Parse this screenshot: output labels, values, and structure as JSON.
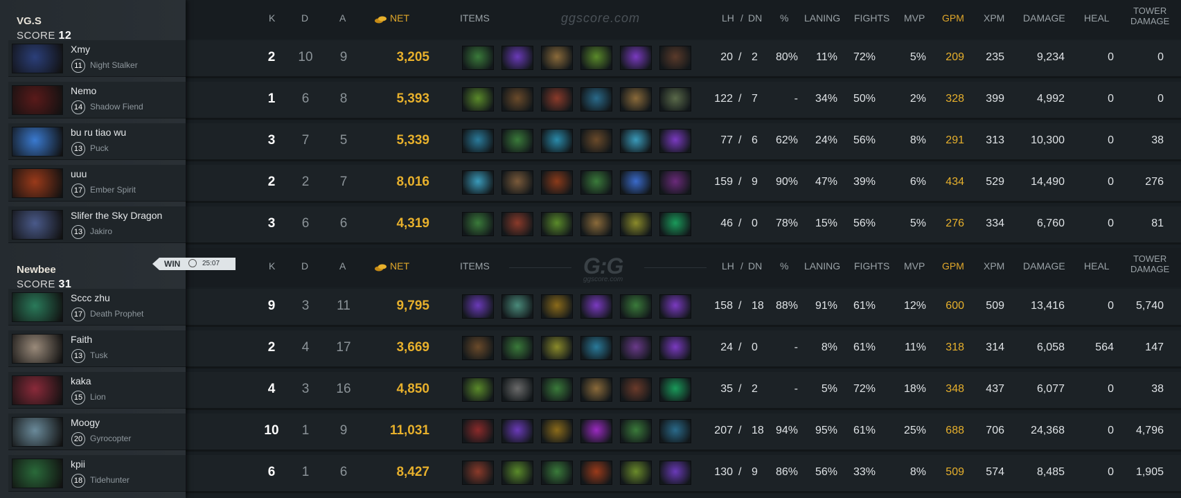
{
  "teams": [
    {
      "name": "VG.S",
      "score_label": "SCORE",
      "score": "12",
      "players": [
        {
          "name": "Xmy",
          "level": "11",
          "hero": "Night Stalker",
          "k": "2",
          "d": "10",
          "a": "9",
          "net": "3,205",
          "lh": "20",
          "dn": "2",
          "pct": "80%",
          "laning": "11%",
          "fights": "72%",
          "mvp": "5%",
          "gpm": "209",
          "xpm": "235",
          "damage": "9,234",
          "heal": "0",
          "tower": "0",
          "items": [
            "#3a7a3a",
            "#6a3ab8",
            "#8a6a3a",
            "#5a8a2a",
            "#7a3ac0",
            "#5a3a2a"
          ],
          "portrait": "#2b3f7a"
        },
        {
          "name": "Nemo",
          "level": "14",
          "hero": "Shadow Fiend",
          "k": "1",
          "d": "6",
          "a": "8",
          "net": "5,393",
          "lh": "122",
          "dn": "7",
          "pct": "-",
          "laning": "34%",
          "fights": "50%",
          "mvp": "2%",
          "gpm": "328",
          "xpm": "399",
          "damage": "4,992",
          "heal": "0",
          "tower": "0",
          "items": [
            "#5a8a2a",
            "#6a4a2a",
            "#8a3a2a",
            "#2a6a8a",
            "#8a6a3a",
            "#5a6a4a"
          ],
          "portrait": "#5a1a1a"
        },
        {
          "name": "bu ru tiao wu",
          "level": "13",
          "hero": "Puck",
          "k": "3",
          "d": "7",
          "a": "5",
          "net": "5,339",
          "lh": "77",
          "dn": "6",
          "pct": "62%",
          "laning": "24%",
          "fights": "56%",
          "mvp": "8%",
          "gpm": "291",
          "xpm": "313",
          "damage": "10,300",
          "heal": "0",
          "tower": "38",
          "items": [
            "#2a7a9a",
            "#3a7a3a",
            "#2a8aaa",
            "#6a4a2a",
            "#3a9aba",
            "#7a3ac0"
          ],
          "portrait": "#3a7ad0"
        },
        {
          "name": "uuu",
          "level": "17",
          "hero": "Ember Spirit",
          "k": "2",
          "d": "2",
          "a": "7",
          "net": "8,016",
          "lh": "159",
          "dn": "9",
          "pct": "90%",
          "laning": "47%",
          "fights": "39%",
          "mvp": "6%",
          "gpm": "434",
          "xpm": "529",
          "damage": "14,490",
          "heal": "0",
          "tower": "276",
          "items": [
            "#3a9aba",
            "#7a5a3a",
            "#8a3a1a",
            "#3a7a3a",
            "#3a6aca",
            "#6a2a7a"
          ],
          "portrait": "#9a3a1a"
        },
        {
          "name": "Slifer the Sky Dragon",
          "level": "13",
          "hero": "Jakiro",
          "k": "3",
          "d": "6",
          "a": "6",
          "net": "4,319",
          "lh": "46",
          "dn": "0",
          "pct": "78%",
          "laning": "15%",
          "fights": "56%",
          "mvp": "5%",
          "gpm": "276",
          "xpm": "334",
          "damage": "6,760",
          "heal": "0",
          "tower": "81",
          "items": [
            "#3a7a3a",
            "#8a3a2a",
            "#5a8a2a",
            "#8a6a3a",
            "#8a8a2a",
            "#1a9a5a"
          ],
          "portrait": "#4a5a8a"
        }
      ]
    },
    {
      "name": "Newbee",
      "score_label": "SCORE",
      "score": "31",
      "players": [
        {
          "name": "Sccc zhu",
          "level": "17",
          "hero": "Death Prophet",
          "k": "9",
          "d": "3",
          "a": "11",
          "net": "9,795",
          "lh": "158",
          "dn": "18",
          "pct": "88%",
          "laning": "91%",
          "fights": "61%",
          "mvp": "12%",
          "gpm": "600",
          "xpm": "509",
          "damage": "13,416",
          "heal": "0",
          "tower": "5,740",
          "items": [
            "#6a3ab8",
            "#4a8a7a",
            "#8a6a1a",
            "#7a3ac0",
            "#3a7a3a",
            "#7a3ac0"
          ],
          "portrait": "#2a7a5a"
        },
        {
          "name": "Faith",
          "level": "13",
          "hero": "Tusk",
          "k": "2",
          "d": "4",
          "a": "17",
          "net": "3,669",
          "lh": "24",
          "dn": "0",
          "pct": "-",
          "laning": "8%",
          "fights": "61%",
          "mvp": "11%",
          "gpm": "318",
          "xpm": "314",
          "damage": "6,058",
          "heal": "564",
          "tower": "147",
          "items": [
            "#6a4a2a",
            "#3a7a3a",
            "#8a8a2a",
            "#2a7a9a",
            "#6a3a8a",
            "#7a3ac0"
          ],
          "portrait": "#9a8a7a"
        },
        {
          "name": "kaka",
          "level": "15",
          "hero": "Lion",
          "k": "4",
          "d": "3",
          "a": "16",
          "net": "4,850",
          "lh": "35",
          "dn": "2",
          "pct": "-",
          "laning": "5%",
          "fights": "72%",
          "mvp": "18%",
          "gpm": "348",
          "xpm": "437",
          "damage": "6,077",
          "heal": "0",
          "tower": "38",
          "items": [
            "#5a8a2a",
            "#6a6a6a",
            "#3a7a3a",
            "#8a6a3a",
            "#6a3a2a",
            "#1a9a5a"
          ],
          "portrait": "#8a2a3a"
        },
        {
          "name": "Moogy",
          "level": "20",
          "hero": "Gyrocopter",
          "k": "10",
          "d": "1",
          "a": "9",
          "net": "11,031",
          "lh": "207",
          "dn": "18",
          "pct": "94%",
          "laning": "95%",
          "fights": "61%",
          "mvp": "25%",
          "gpm": "688",
          "xpm": "706",
          "damage": "24,368",
          "heal": "0",
          "tower": "4,796",
          "items": [
            "#8a2a2a",
            "#6a3ab8",
            "#8a6a1a",
            "#9a2ac0",
            "#3a7a3a",
            "#2a6a8a"
          ],
          "portrait": "#6a8a9a"
        },
        {
          "name": "kpii",
          "level": "18",
          "hero": "Tidehunter",
          "k": "6",
          "d": "1",
          "a": "6",
          "net": "8,427",
          "lh": "130",
          "dn": "9",
          "pct": "86%",
          "laning": "56%",
          "fights": "33%",
          "mvp": "8%",
          "gpm": "509",
          "xpm": "574",
          "damage": "8,485",
          "heal": "0",
          "tower": "1,905",
          "items": [
            "#8a3a2a",
            "#5a8a2a",
            "#3a7a3a",
            "#9a3a1a",
            "#6a8a2a",
            "#6a3ab8"
          ],
          "portrait": "#2a6a3a"
        }
      ]
    }
  ],
  "result": {
    "label": "WIN",
    "time": "25:07"
  },
  "headers": {
    "k": "K",
    "d": "D",
    "a": "A",
    "net": "NET",
    "items": "ITEMS",
    "lh": "LH",
    "slash": "/",
    "dn": "DN",
    "pct": "%",
    "laning": "LANING",
    "fights": "FIGHTS",
    "mvp": "MVP",
    "gpm": "GPM",
    "xpm": "XPM",
    "damage": "DAMAGE",
    "heal": "HEAL",
    "tower1": "TOWER",
    "tower2": "DAMAGE"
  },
  "watermarks": {
    "top": "ggscore.com",
    "logo": "G:G",
    "logo_sub": "ggscore.com"
  },
  "colors": {
    "gold": "#e7b02c",
    "text": "#dfe3e6",
    "muted": "#8b9398"
  }
}
